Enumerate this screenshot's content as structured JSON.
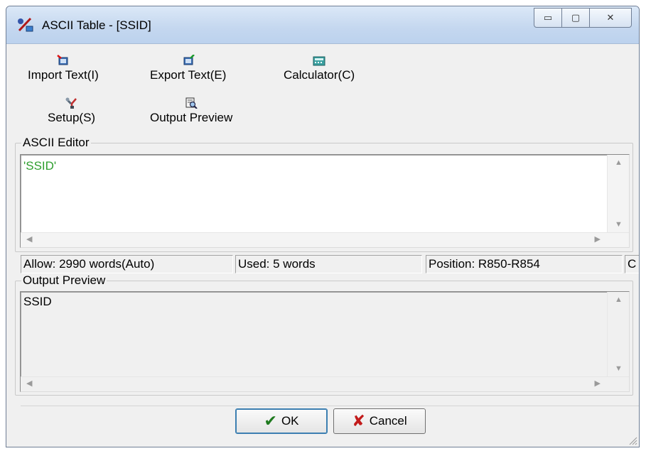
{
  "window": {
    "title": "ASCII Table - [SSID]",
    "min_glyph": "▭",
    "max_glyph": "▢",
    "close_glyph": "✕"
  },
  "toolbar": {
    "import_label": "Import Text(I)",
    "export_label": "Export Text(E)",
    "calculator_label": "Calculator(C)",
    "setup_label": "Setup(S)",
    "preview_label": "Output Preview"
  },
  "ascii_editor": {
    "title": "ASCII Editor",
    "content": "'SSID'",
    "content_color": "#2e9e2e"
  },
  "status": {
    "allow": "Allow: 2990 words(Auto)",
    "used": "Used: 5 words",
    "position": "Position: R850-R854",
    "extra": "C"
  },
  "output_preview": {
    "title": "Output Preview",
    "content": "SSID"
  },
  "buttons": {
    "ok_label": "OK",
    "cancel_label": "Cancel",
    "ok_icon": "✔",
    "cancel_icon": "✘",
    "ok_icon_color": "#1f7a1f",
    "cancel_icon_color": "#c21b1b"
  }
}
